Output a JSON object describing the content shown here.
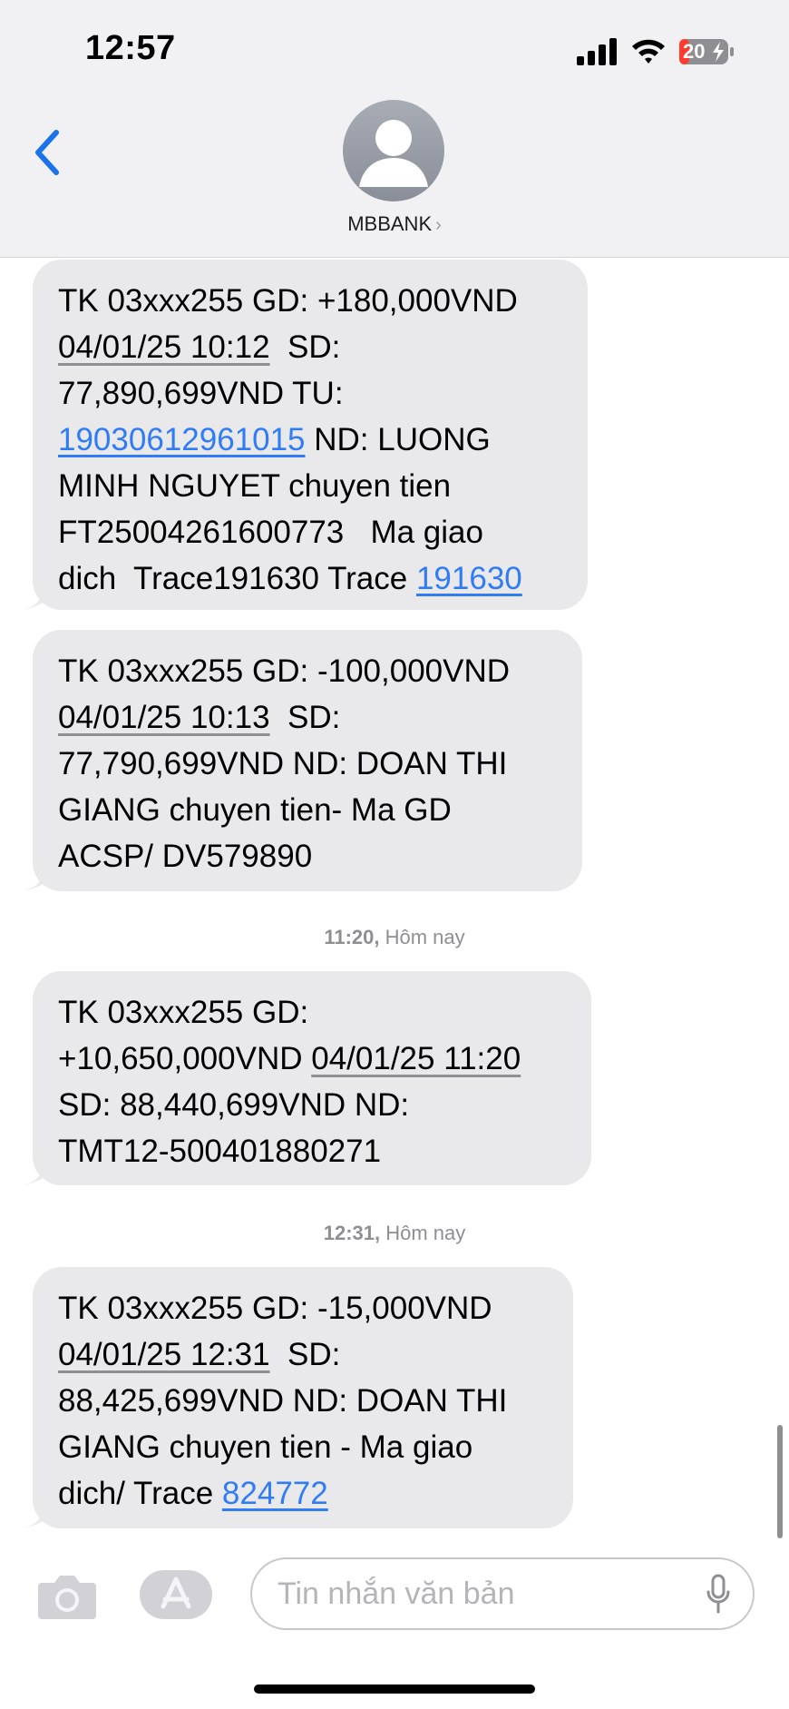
{
  "status_bar": {
    "time": "12:57",
    "battery_level": "20",
    "icons": [
      "cellular-signal-icon",
      "wifi-icon",
      "battery-charging-icon"
    ]
  },
  "header": {
    "back_icon": "chevron-left-icon",
    "contact_name": "MBBANK",
    "contact_chevron": "›",
    "avatar_icon": "person-silhouette-icon"
  },
  "messages": [
    {
      "lines": [
        [
          {
            "t": "TK 03xxx255 GD: +180,000VND"
          }
        ],
        [
          {
            "t": "04/01/25 10:12",
            "k": "date"
          },
          {
            "t": "  SD:"
          }
        ],
        [
          {
            "t": "77,890,699VND TU:"
          }
        ],
        [
          {
            "t": "19030612961015",
            "k": "link"
          },
          {
            "t": " ND: LUONG"
          }
        ],
        [
          {
            "t": "MINH NGUYET chuyen tien"
          }
        ],
        [
          {
            "t": "FT25004261600773   Ma giao"
          }
        ],
        [
          {
            "t": "dich  Trace191630 Trace "
          },
          {
            "t": "191630",
            "k": "link"
          }
        ]
      ]
    },
    {
      "lines": [
        [
          {
            "t": "TK 03xxx255 GD: -100,000VND"
          }
        ],
        [
          {
            "t": "04/01/25 10:13",
            "k": "date"
          },
          {
            "t": "  SD:"
          }
        ],
        [
          {
            "t": "77,790,699VND ND: DOAN THI"
          }
        ],
        [
          {
            "t": "GIANG chuyen tien- Ma GD"
          }
        ],
        [
          {
            "t": "ACSP/ DV579890"
          }
        ]
      ]
    },
    {
      "lines": [
        [
          {
            "t": "TK 03xxx255 GD:"
          }
        ],
        [
          {
            "t": "+10,650,000VND "
          },
          {
            "t": "04/01/25 11:20",
            "k": "date"
          }
        ],
        [
          {
            "t": "SD: 88,440,699VND ND:"
          }
        ],
        [
          {
            "t": "TMT12-500401880271"
          }
        ]
      ]
    },
    {
      "lines": [
        [
          {
            "t": "TK 03xxx255 GD: -15,000VND"
          }
        ],
        [
          {
            "t": "04/01/25 12:31",
            "k": "date"
          },
          {
            "t": "  SD:"
          }
        ],
        [
          {
            "t": "88,425,699VND ND: DOAN THI"
          }
        ],
        [
          {
            "t": "GIANG chuyen tien - Ma giao"
          }
        ],
        [
          {
            "t": "dich/ Trace "
          },
          {
            "t": "824772",
            "k": "link"
          }
        ]
      ]
    }
  ],
  "timestamps": [
    {
      "time": "11:20,",
      "day": " Hôm nay"
    },
    {
      "time": "12:31,",
      "day": " Hôm nay"
    }
  ],
  "input_bar": {
    "camera_icon": "camera-icon",
    "apps_icon": "app-store-icon",
    "placeholder": "Tin nhắn văn bản",
    "mic_icon": "microphone-icon"
  },
  "colors": {
    "header_bg": "#f1f1f3",
    "bubble_bg": "#e9e9eb",
    "link": "#2f7cf6",
    "accent": "#1a73e8",
    "secondary_text": "#8e8e93",
    "battery_low": "#ff3b30"
  }
}
